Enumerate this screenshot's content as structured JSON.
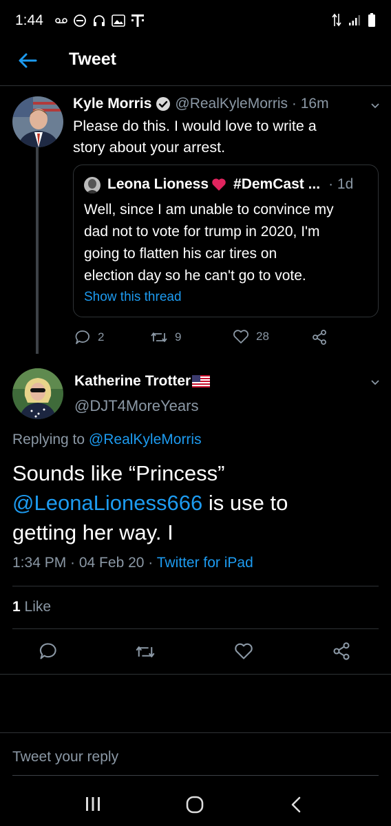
{
  "status_bar": {
    "time": "1:44"
  },
  "header": {
    "title": "Tweet"
  },
  "parent_tweet": {
    "author_name": "Kyle Morris",
    "handle_time": "@RealKyleMorris · 16m",
    "text_lines": [
      "Please do this. I would love to write a",
      "story about your arrest."
    ],
    "quote": {
      "author_name": "Leona Lioness",
      "author_tag": "#DemCast ...",
      "time": "· 1d",
      "text_lines": [
        "Well, since I am unable to convince my",
        "dad not to vote for trump in 2020, I'm",
        "going to flatten his car tires on",
        "election day so he can't go to vote."
      ],
      "show_thread": "Show this thread"
    },
    "replies": "2",
    "retweets": "9",
    "likes": "28"
  },
  "main_tweet": {
    "author_name": "Katherine Trotter",
    "handle": "@DJT4MoreYears",
    "replying_prefix": "Replying to",
    "replying_handle": "@RealKyleMorris",
    "text_line1": "Sounds like “Princess”",
    "mention": "@LeonaLioness666",
    "text_line2_rest": " is use to",
    "text_line3": "getting her way. I",
    "timestamp": "1:34 PM · 04 Feb 20 · ",
    "source": "Twitter for iPad",
    "like_count": "1",
    "like_label": " Like"
  },
  "reply_box": {
    "placeholder": "Tweet your reply"
  },
  "colors": {
    "accent": "#1d9bf0",
    "muted": "#8b98a5",
    "heart": "#e0245e"
  }
}
